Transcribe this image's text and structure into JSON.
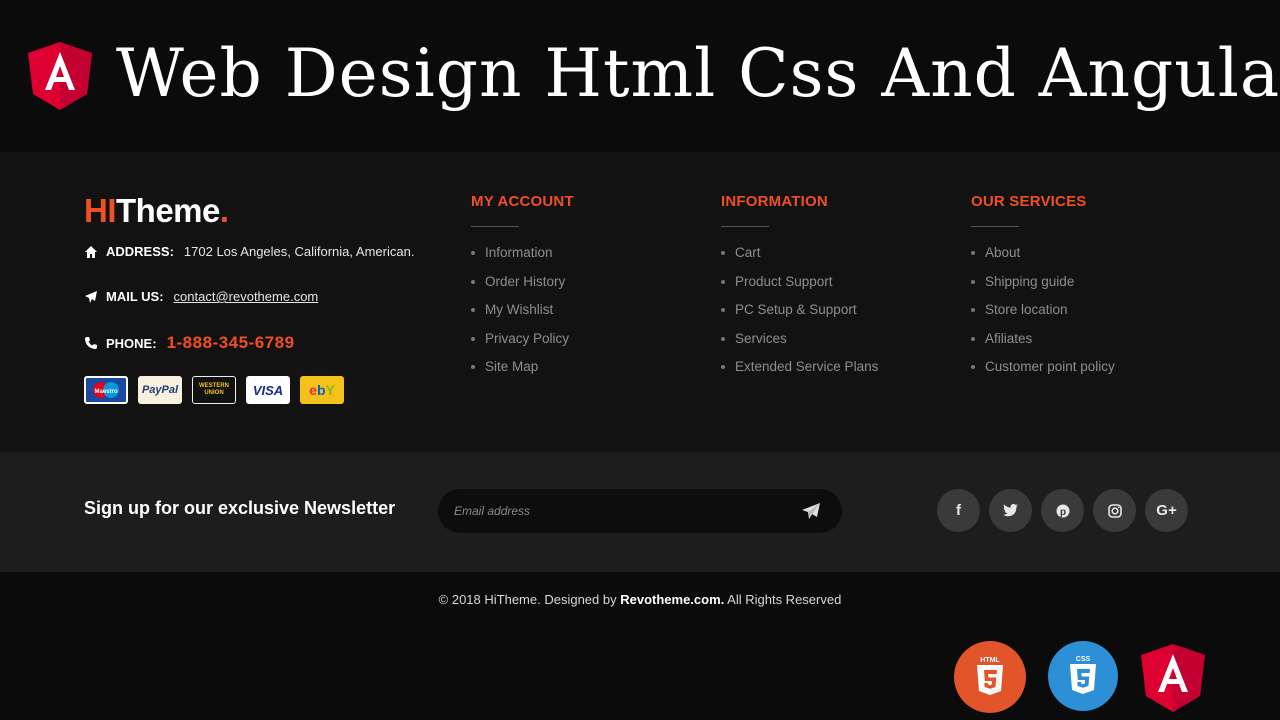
{
  "banner": {
    "title": "Web Design Html Css And Angular",
    "logo_icon": "angular-icon"
  },
  "brand": {
    "hi": "HI",
    "rest": "Theme",
    "dot": "."
  },
  "contact": {
    "address_label": "ADDRESS:",
    "address_value": "1702 Los Angeles, California, American.",
    "mail_label": "MAIL US:",
    "mail_value": "contact@revotheme.com",
    "phone_label": "PHONE:",
    "phone_value": "1-888-345-6789"
  },
  "payments": [
    {
      "name": "Maestro"
    },
    {
      "name": "PayPal"
    },
    {
      "name": "WESTERN UNION"
    },
    {
      "name": "VISA"
    },
    {
      "name": "ebY"
    }
  ],
  "columns": [
    {
      "title": "MY ACCOUNT",
      "items": [
        "Information",
        "Order History",
        "My Wishlist",
        "Privacy Policy",
        "Site Map"
      ]
    },
    {
      "title": "INFORMATION",
      "items": [
        "Cart",
        "Product Support",
        "PC Setup & Support",
        "Services",
        "Extended Service Plans"
      ]
    },
    {
      "title": "OUR SERVICES",
      "items": [
        "About",
        "Shipping guide",
        "Store location",
        "Afiliates",
        "Customer point policy"
      ]
    }
  ],
  "newsletter": {
    "title": "Sign up for our exclusive Newsletter",
    "placeholder": "Email address"
  },
  "socials": [
    {
      "icon": "facebook-icon",
      "glyph": "f"
    },
    {
      "icon": "twitter-icon",
      "glyph": "t"
    },
    {
      "icon": "pinterest-icon",
      "glyph": "p"
    },
    {
      "icon": "instagram-icon",
      "glyph": "◎"
    },
    {
      "icon": "google-plus-icon",
      "glyph": "G+"
    }
  ],
  "copyright": {
    "prefix": "© 2018 HiTheme. Designed by ",
    "brand": "Revotheme.com.",
    "suffix": " All Rights Reserved"
  },
  "tech_logos": {
    "html_label": "HTML",
    "css_label": "CSS"
  },
  "colors": {
    "accent": "#f04e23",
    "background": "#121213",
    "newsletter_bg": "#1d1d1e"
  }
}
